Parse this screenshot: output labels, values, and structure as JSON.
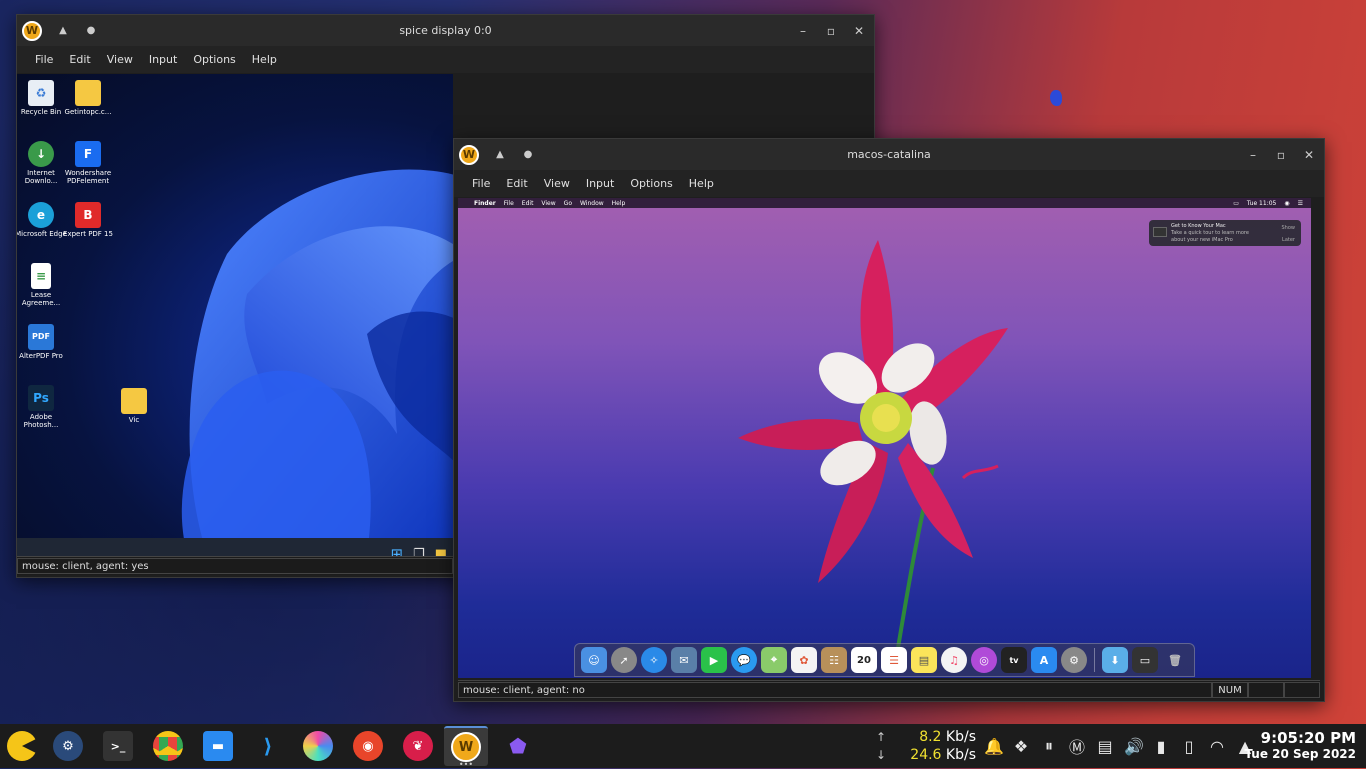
{
  "desktop": {
    "accent": "#f0a81a"
  },
  "spice_window": {
    "title": "spice display 0:0",
    "menu": [
      "File",
      "Edit",
      "View",
      "Input",
      "Options",
      "Help"
    ],
    "desktop_icons": [
      {
        "label": "Recycle Bin",
        "icon": "recycle-bin-icon"
      },
      {
        "label": "Getintopc.c...",
        "icon": "folder-icon"
      },
      {
        "label": "Internet Downlo...",
        "icon": "internet-download-icon"
      },
      {
        "label": "Wondershare PDFelement",
        "icon": "pdfelement-icon"
      },
      {
        "label": "Microsoft Edge",
        "icon": "edge-icon"
      },
      {
        "label": "Expert PDF 15",
        "icon": "expert-pdf-icon"
      },
      {
        "label": "Lease Agreeme...",
        "icon": "document-icon"
      },
      {
        "label": "AlterPDF Pro",
        "icon": "alterpdf-icon"
      },
      {
        "label": "Adobe Photosh...",
        "icon": "photoshop-icon"
      },
      {
        "label": "Vic",
        "icon": "folder-icon"
      }
    ],
    "status": "mouse: client, agent: yes"
  },
  "macos_window": {
    "title": "macos-catalina",
    "menu": [
      "File",
      "Edit",
      "View",
      "Input",
      "Options",
      "Help"
    ],
    "mac_menubar": [
      "Finder",
      "File",
      "Edit",
      "View",
      "Go",
      "Window",
      "Help"
    ],
    "mac_clock": "Tue 11:05",
    "notification": {
      "title": "Get to Know Your Mac",
      "body": "Take a quick tour to learn more about your new iMac Pro",
      "show": "Show",
      "later": "Later"
    },
    "dock_calendar_day": "20",
    "dock_tv": "tv",
    "status": "mouse: client, agent: no",
    "status_num": "NUM"
  },
  "host_taskbar": {
    "upload_speed": "8.2",
    "download_speed": "24.6",
    "speed_unit": "Kb/s",
    "time": "9:05:20 PM",
    "date": "Tue 20 Sep 2022"
  }
}
